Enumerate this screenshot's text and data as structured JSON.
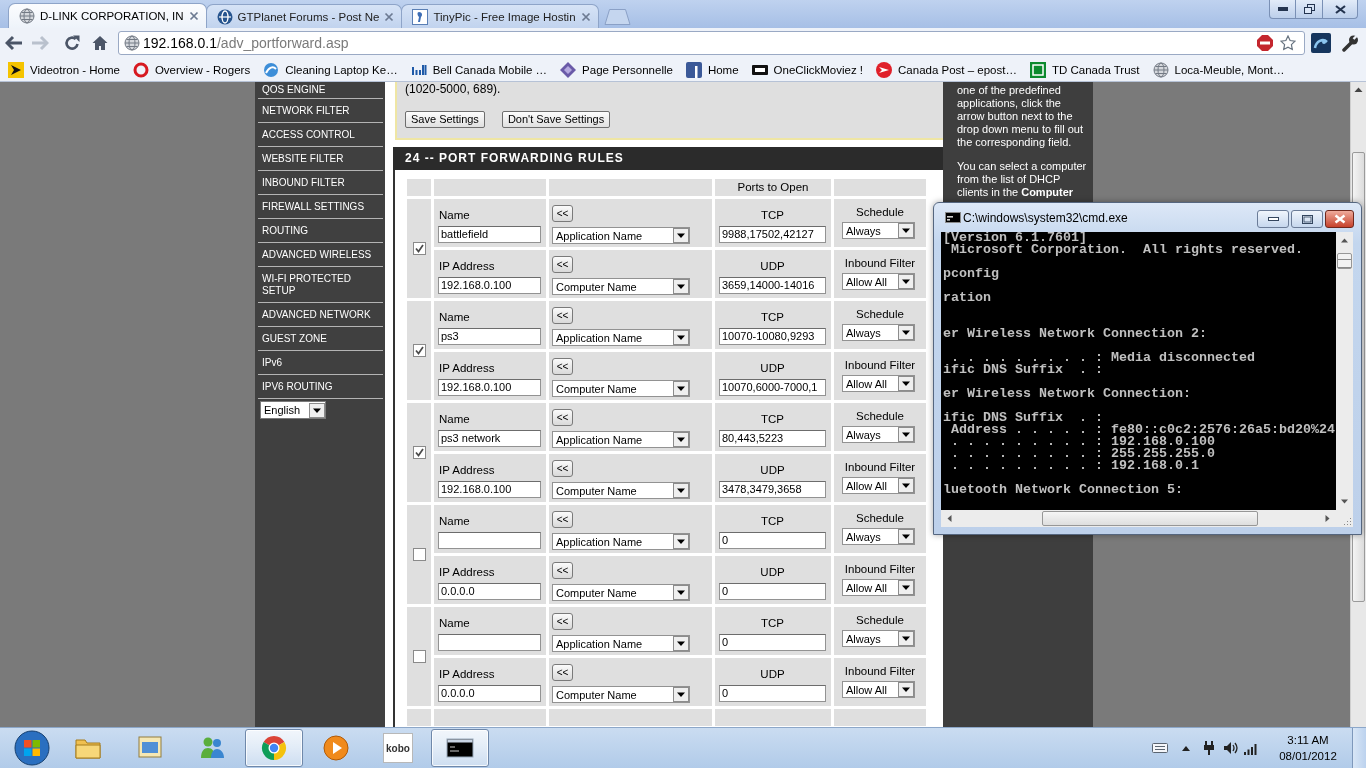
{
  "browser": {
    "tabs": [
      {
        "title": "D-LINK CORPORATION, IN",
        "kind": "globe",
        "selected": true
      },
      {
        "title": "GTPlanet Forums - Post Ne",
        "kind": "sphere",
        "selected": false
      },
      {
        "title": "TinyPic - Free Image Hostin",
        "kind": "tile",
        "selected": false
      }
    ],
    "nav_buttons": [
      {
        "kind": "back",
        "disabled": false
      },
      {
        "kind": "forward",
        "disabled": true
      },
      {
        "kind": "reload",
        "disabled": false
      },
      {
        "kind": "home",
        "disabled": false
      }
    ],
    "address": {
      "host": "192.168.0.1",
      "path": "/adv_portforward.asp"
    },
    "bookmarks": [
      {
        "label": "Videotron - Home",
        "kind": "arrow"
      },
      {
        "label": "Overview - Rogers",
        "kind": "ring"
      },
      {
        "label": "Cleaning Laptop Ke…",
        "kind": "swirl"
      },
      {
        "label": "Bell Canada Mobile …",
        "kind": "bars"
      },
      {
        "label": "Page Personnelle",
        "kind": "diamond"
      },
      {
        "label": "Home",
        "kind": "square"
      },
      {
        "label": "OneClickMoviez !",
        "kind": "plate"
      },
      {
        "label": "Canada Post – epost…",
        "kind": "chevron"
      },
      {
        "label": "TD Canada Trust",
        "kind": "block"
      },
      {
        "label": "Loca-Meuble, Mont…",
        "kind": "globe"
      }
    ]
  },
  "sidebar": {
    "items": [
      {
        "label": "QOS ENGINE",
        "selected": false
      },
      {
        "label": "NETWORK FILTER",
        "selected": false
      },
      {
        "label": "ACCESS CONTROL",
        "selected": false
      },
      {
        "label": "WEBSITE FILTER",
        "selected": false
      },
      {
        "label": "INBOUND FILTER",
        "selected": false
      },
      {
        "label": "FIREWALL SETTINGS",
        "selected": false
      },
      {
        "label": "ROUTING",
        "selected": false
      },
      {
        "label": "ADVANCED WIRELESS",
        "selected": false
      },
      {
        "label": "WI-FI PROTECTED SETUP",
        "selected": false
      },
      {
        "label": "ADVANCED NETWORK",
        "selected": false
      },
      {
        "label": "GUEST ZONE",
        "selected": false
      },
      {
        "label": "IPv6",
        "selected": false
      },
      {
        "label": "IPV6 ROUTING",
        "selected": false
      }
    ],
    "language": {
      "value": "English"
    }
  },
  "main": {
    "note": "(1020-5000, 689).",
    "buttons": [
      "Save Settings",
      "Don't Save Settings"
    ],
    "section_title": "24 -- PORT FORWARDING RULES",
    "table": {
      "header": "Ports to Open",
      "rules": [
        {
          "checked": true,
          "name_label": "Name",
          "name": "battlefield",
          "app_button": "<<",
          "app": "Application Name",
          "tcp_label": "TCP",
          "tcp": "9988,17502,42127",
          "schedule_label": "Schedule",
          "schedule": "Always",
          "ip_label": "IP Address",
          "ip": "192.168.0.100",
          "computer_button": "<<",
          "computer": "Computer Name",
          "udp_label": "UDP",
          "udp": "3659,14000-14016",
          "filter_label": "Inbound Filter",
          "filter": "Allow All"
        },
        {
          "checked": true,
          "name_label": "Name",
          "name": "ps3",
          "app_button": "<<",
          "app": "Application Name",
          "tcp_label": "TCP",
          "tcp": "10070-10080,9293",
          "schedule_label": "Schedule",
          "schedule": "Always",
          "ip_label": "IP Address",
          "ip": "192.168.0.100",
          "computer_button": "<<",
          "computer": "Computer Name",
          "udp_label": "UDP",
          "udp": "10070,6000-7000,1",
          "filter_label": "Inbound Filter",
          "filter": "Allow All"
        },
        {
          "checked": true,
          "name_label": "Name",
          "name": "ps3 network",
          "app_button": "<<",
          "app": "Application Name",
          "tcp_label": "TCP",
          "tcp": "80,443,5223",
          "schedule_label": "Schedule",
          "schedule": "Always",
          "ip_label": "IP Address",
          "ip": "192.168.0.100",
          "computer_button": "<<",
          "computer": "Computer Name",
          "udp_label": "UDP",
          "udp": "3478,3479,3658",
          "filter_label": "Inbound Filter",
          "filter": "Allow All"
        },
        {
          "checked": false,
          "name_label": "Name",
          "app_button": "<<",
          "app": "Application Name",
          "tcp_label": "TCP",
          "tcp": "0",
          "schedule_label": "Schedule",
          "schedule": "Always",
          "ip_label": "IP Address",
          "ip": "0.0.0.0",
          "computer_button": "<<",
          "computer": "Computer Name",
          "udp_label": "UDP",
          "udp": "0",
          "filter_label": "Inbound Filter",
          "filter": "Allow All"
        },
        {
          "checked": false,
          "name_label": "Name",
          "app_button": "<<",
          "app": "Application Name",
          "tcp_label": "TCP",
          "tcp": "0",
          "schedule_label": "Schedule",
          "schedule": "Always",
          "ip_label": "IP Address",
          "ip": "0.0.0.0",
          "computer_button": "<<",
          "computer": "Computer Name",
          "udp_label": "UDP",
          "udp": "0",
          "filter_label": "Inbound Filter",
          "filter": "Allow All"
        }
      ]
    }
  },
  "help": {
    "paragraphs": [
      "one of the predefined applications, click the arrow button next to the drop down menu to fill out the corresponding field.",
      "You can select a computer from the list of DHCP clients in the **Computer**"
    ]
  },
  "console_window": {
    "title": "C:\\windows\\system32\\cmd.exe",
    "output": "[Version 6.1.7601]\n Microsoft Corporation.  All rights reserved.\n\npconfig\n\nration\n\n\ner Wireless Network Connection 2:\n\n . . . . . . . . . : Media disconnected\nific DNS Suffix  . :\n\ner Wireless Network Connection:\n\nific DNS Suffix  . :\n Address . . . . . : fe80::c0c2:2576:26a5:bd20%24\n . . . . . . . . . : 192.168.0.100\n . . . . . . . . . : 255.255.255.0\n . . . . . . . . . : 192.168.0.1\n\nluetooth Network Connection 5:"
  },
  "taskbar": {
    "apps": [
      {
        "kind": "folder",
        "running": false
      },
      {
        "kind": "window",
        "running": false
      },
      {
        "kind": "people",
        "running": false
      },
      {
        "kind": "browser",
        "running": true
      },
      {
        "kind": "player",
        "running": false
      },
      {
        "kind": "tile",
        "label": "kobo",
        "running": false
      },
      {
        "kind": "console",
        "running": true
      }
    ],
    "clock": {
      "time": "3:11 AM",
      "date": "08/01/2012"
    }
  }
}
